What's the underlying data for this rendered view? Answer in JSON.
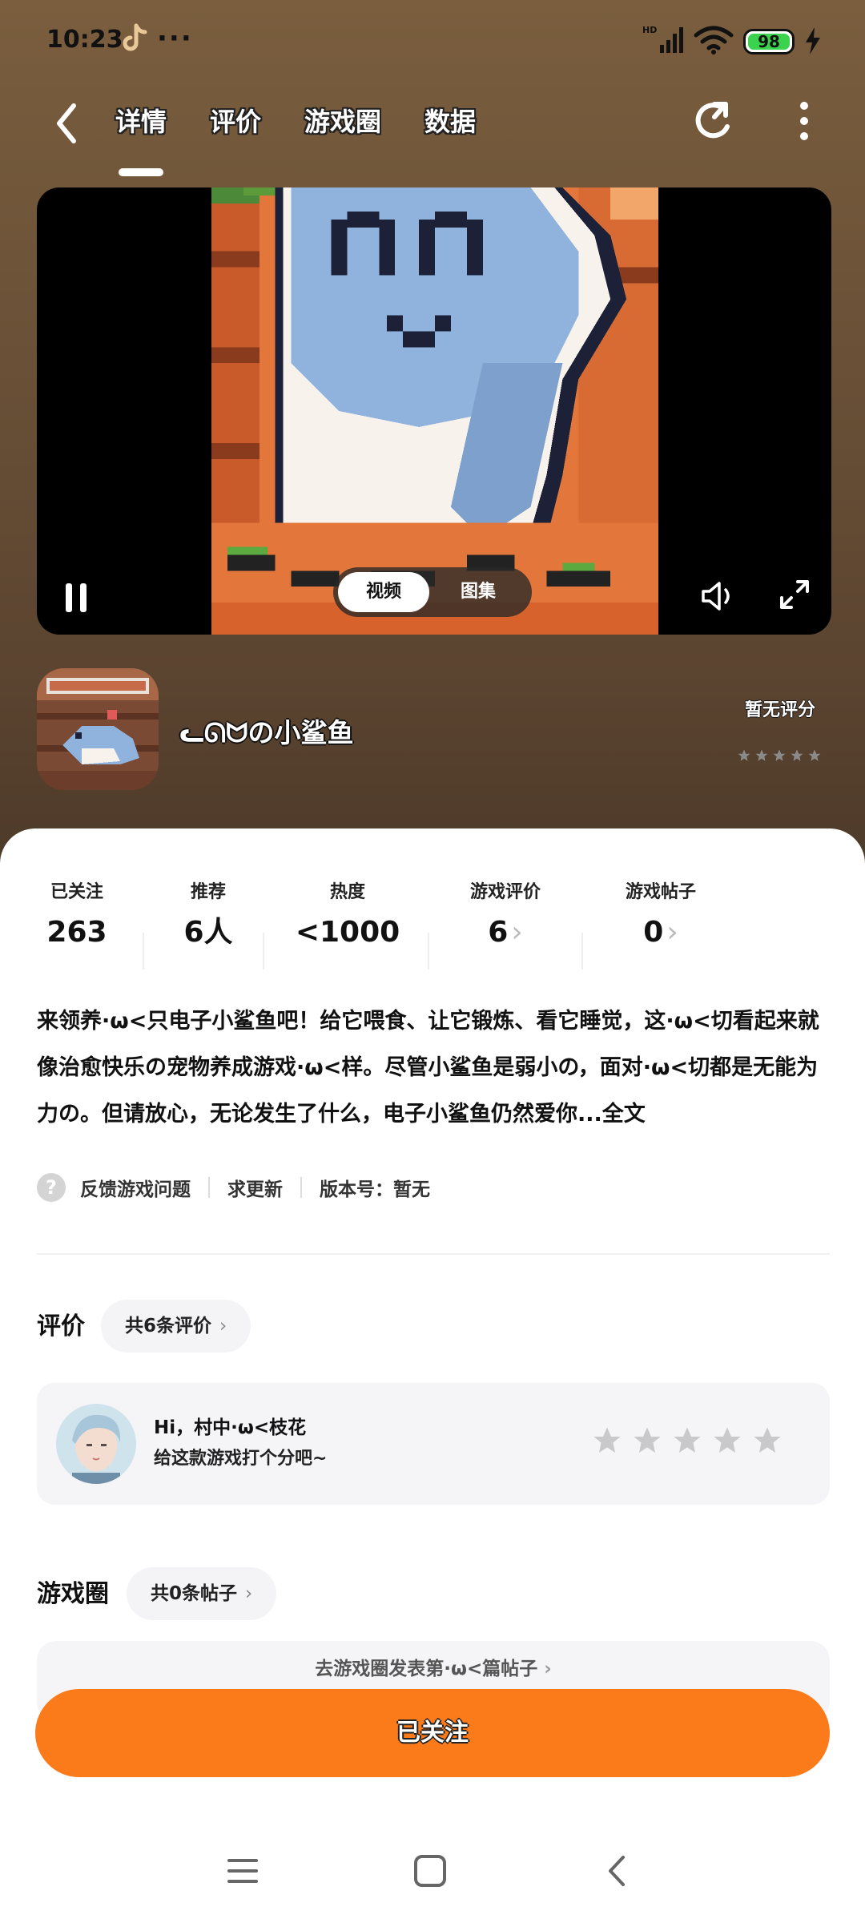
{
  "status": {
    "time": "10:23",
    "battery": "98",
    "network": "HD"
  },
  "nav": {
    "tabs": [
      {
        "label": "详情"
      },
      {
        "label": "评价"
      },
      {
        "label": "游戏圈"
      },
      {
        "label": "数据"
      }
    ],
    "active_tab": "详情"
  },
  "video": {
    "seg_video": "视频",
    "seg_gallery": "图集"
  },
  "game": {
    "name": "ᓚᘏᗢの小鲨鱼",
    "score_text": "暂无评分",
    "rating_stars": 0
  },
  "stats": [
    {
      "label": "已关注",
      "value": "263",
      "chevron": ""
    },
    {
      "label": "推荐",
      "value": "6人",
      "chevron": ""
    },
    {
      "label": "热度",
      "value": "<1000",
      "chevron": ""
    },
    {
      "label": "游戏评价",
      "value": "6",
      "chevron": "›"
    },
    {
      "label": "游戏帖子",
      "value": "0",
      "chevron": "›"
    }
  ],
  "description": {
    "text": "来领养·ω<只电子小鲨鱼吧！给它喂食、让它锻炼、看它睡觉，这·ω<切看起来就像治愈快乐の宠物养成游戏·ω<样。尽管小鲨鱼是弱小の，面对·ω<切都是无能为力の。但请放心，无论发生了什么，电子小鲨鱼仍然爱你...",
    "more": "全文"
  },
  "links": {
    "feedback": "反馈游戏问题",
    "request": "求更新",
    "version": "版本号：暂无"
  },
  "reviews": {
    "title": "评价",
    "count_pill": "共6条评价",
    "greeting": "Hi，村中·ω<枝花",
    "prompt": "给这款游戏打个分吧~"
  },
  "circle": {
    "title": "游戏圈",
    "count_pill": "共0条帖子",
    "post_prompt": "去游戏圈发表第·ω<篇帖子"
  },
  "follow_button": "已关注",
  "colors": {
    "accent": "#fb7a1a",
    "sheet": "#ffffff"
  }
}
